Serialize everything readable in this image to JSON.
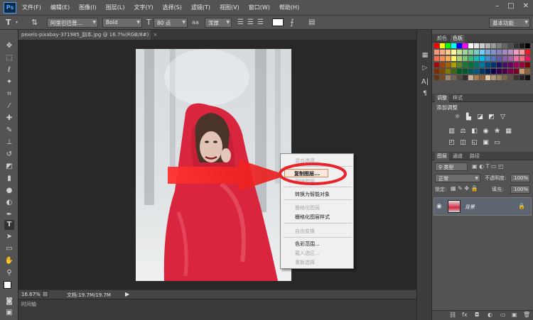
{
  "app": {
    "logo": "Ps",
    "menu": [
      "文件(F)",
      "编辑(E)",
      "图像(I)",
      "图层(L)",
      "文字(Y)",
      "选择(S)",
      "滤镜(T)",
      "视图(V)",
      "窗口(W)",
      "帮助(H)"
    ],
    "window_controls": [
      "–",
      "□",
      "✕"
    ]
  },
  "options_bar": {
    "tool_icon": "text-tool-icon",
    "font_family": "阿里巴巴普...",
    "font_style": "Bold",
    "font_size": "80 点",
    "aa_mode": "浑厚",
    "workspace": "基本功能"
  },
  "document": {
    "tab_title": "pexels-pixabay-371985_副本.jpg @ 16.7%(RGB/8#)",
    "tab_close": "×"
  },
  "context_menu": {
    "items": [
      {
        "label": "混合选项...",
        "disabled": true
      },
      {
        "label": "复制图层...",
        "disabled": false,
        "highlight": true
      },
      {
        "label": "删除图层",
        "disabled": true
      },
      {
        "label": "转换为智能对象",
        "disabled": false
      },
      {
        "label": "栅格化图层",
        "disabled": true
      },
      {
        "label": "栅格化图层样式",
        "disabled": false
      },
      {
        "label": "自由变换",
        "disabled": true
      },
      {
        "label": "色彩范围...",
        "disabled": false
      },
      {
        "label": "载入选区...",
        "disabled": true
      },
      {
        "label": "重新选择",
        "disabled": true
      }
    ]
  },
  "status": {
    "zoom": "16.67%",
    "doc_size": "文档:19.7M/19.7M",
    "timeline": "时间轴"
  },
  "panels": {
    "color_tabs": [
      "颜色",
      "色板"
    ],
    "adjust_tabs": [
      "调整",
      "样式"
    ],
    "adjust_title": "添加调整",
    "layers_tabs": [
      "图层",
      "通道",
      "路径"
    ],
    "filter_type": "类型",
    "blend_mode": "正常",
    "opacity_label": "不透明度:",
    "opacity_value": "100%",
    "lock_label": "锁定:",
    "fill_label": "填充:",
    "fill_value": "100%",
    "layer_name": "背景"
  },
  "colors": {
    "accent_red": "#e8232b",
    "arrow_red": "#ef2b2d",
    "scarf_red": "#d9263e"
  }
}
